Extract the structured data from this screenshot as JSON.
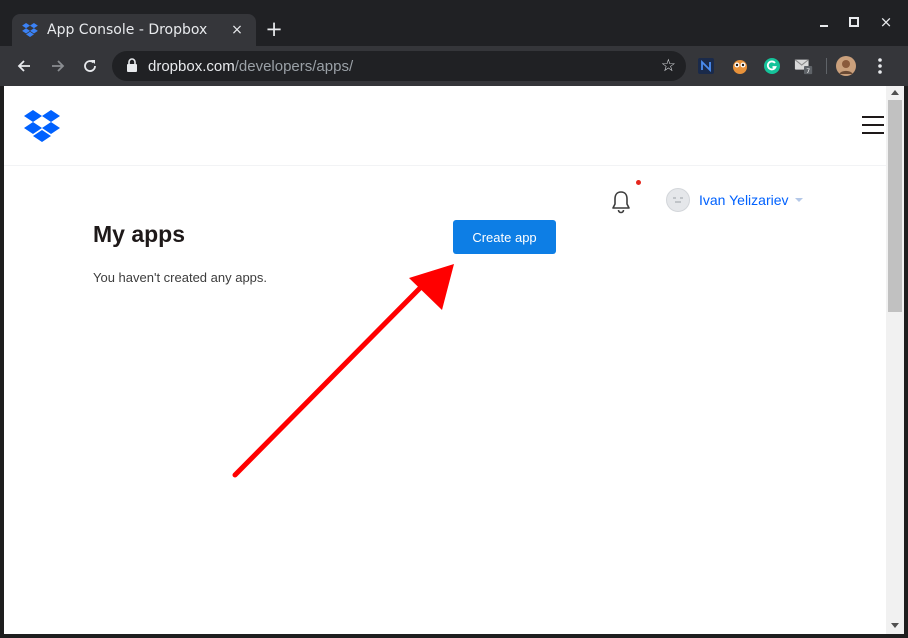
{
  "browser": {
    "tab_title": "App Console - Dropbox",
    "tab_close": "×",
    "new_tab": "+",
    "address_host": "dropbox.com",
    "address_path": "/developers/apps/",
    "bookmark_star": "☆",
    "window_close": "×"
  },
  "header": {
    "logo": "dropbox-logo",
    "menu_icon": "hamburger-menu-icon"
  },
  "account": {
    "name": "Ivan Yelizariev",
    "has_notification": true
  },
  "main": {
    "title": "My apps",
    "create_button_label": "Create app",
    "empty_message": "You haven't created any apps."
  },
  "annotation": {
    "type": "arrow",
    "color": "#ff0000",
    "target": "create-app-button"
  },
  "colors": {
    "dropbox_blue": "#0061fe",
    "button_blue": "#0d7ee5",
    "notification_dot": "#e5261d"
  }
}
